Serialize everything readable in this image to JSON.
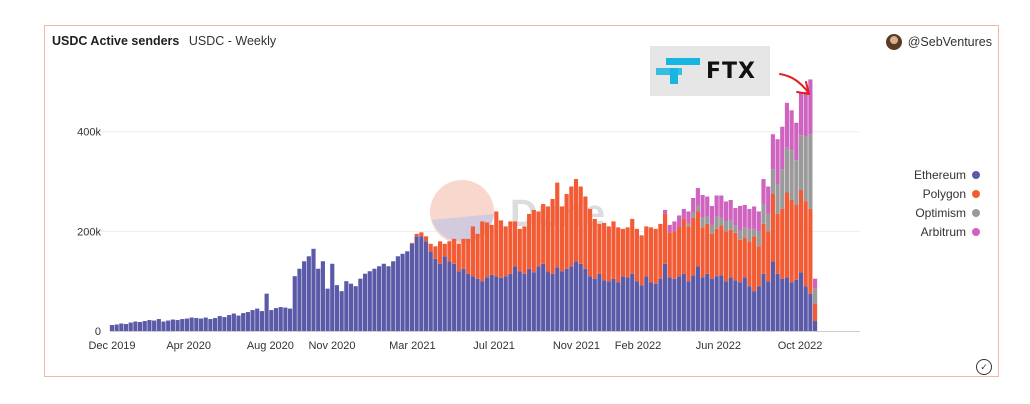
{
  "title": "USDC Active senders",
  "subtitle": "USDC - Weekly",
  "author": "@SebVentures",
  "annotation_logo_text": "FTX",
  "watermark": "Dune",
  "colors": {
    "ethereum": "#5a5aa8",
    "polygon": "#f25b34",
    "optimism": "#9a9a9a",
    "arbitrum": "#cf63c0",
    "annotation_arrow": "#e02020",
    "ftx_accent": "#17b5e1"
  },
  "icons": {
    "check": "check-circle-icon",
    "avatar": "avatar",
    "logo": "ftx-logo"
  },
  "chart_data": {
    "type": "bar",
    "stacked": true,
    "interval": "weekly",
    "start_week": "2019-12-09",
    "end_week": "2022-12-26",
    "ylim": [
      0,
      540000
    ],
    "yticks": [
      0,
      200000,
      400000
    ],
    "ytick_labels": [
      "0",
      "200k",
      "400k"
    ],
    "xtick_labels": [
      "Dec 2019",
      "Apr 2020",
      "Aug 2020",
      "Nov 2020",
      "Mar 2021",
      "Jul 2021",
      "Nov 2021",
      "Feb 2022",
      "Jun 2022",
      "Oct 2022"
    ],
    "xtick_dates": [
      "2019-12-01",
      "2020-04-01",
      "2020-08-01",
      "2020-11-01",
      "2021-03-01",
      "2021-07-01",
      "2021-11-01",
      "2022-02-01",
      "2022-06-01",
      "2022-10-01"
    ],
    "legend_position": "right",
    "grid": "horizontal",
    "series": [
      {
        "name": "Ethereum",
        "color": "#5a5aa8",
        "values": [
          12000,
          13000,
          15000,
          14000,
          17000,
          19000,
          18000,
          20000,
          22000,
          21000,
          24000,
          19000,
          21000,
          23000,
          22000,
          24000,
          25000,
          27000,
          26000,
          25000,
          27000,
          24000,
          26000,
          30000,
          28000,
          32000,
          35000,
          31000,
          36000,
          38000,
          42000,
          45000,
          40000,
          75000,
          42000,
          46000,
          48000,
          47000,
          45000,
          110000,
          125000,
          140000,
          150000,
          165000,
          125000,
          140000,
          85000,
          135000,
          92000,
          80000,
          100000,
          95000,
          90000,
          105000,
          115000,
          120000,
          125000,
          130000,
          135000,
          130000,
          140000,
          150000,
          155000,
          160000,
          175000,
          190000,
          190000,
          180000,
          160000,
          145000,
          135000,
          150000,
          140000,
          135000,
          120000,
          125000,
          115000,
          110000,
          105000,
          100000,
          108000,
          113000,
          110000,
          107000,
          110000,
          115000,
          130000,
          120000,
          115000,
          125000,
          118000,
          130000,
          135000,
          120000,
          115000,
          128000,
          120000,
          125000,
          130000,
          140000,
          135000,
          125000,
          110000,
          105000,
          115000,
          102000,
          100000,
          105000,
          98000,
          110000,
          108000,
          115000,
          100000,
          92000,
          110000,
          98000,
          95000,
          105000,
          135000,
          108000,
          105000,
          110000,
          115000,
          100000,
          112000,
          130000,
          108000,
          115000,
          105000,
          110000,
          112000,
          100000,
          108000,
          102000,
          98000,
          108000,
          90000,
          80000,
          90000,
          115000,
          100000,
          140000,
          115000,
          105000,
          108000,
          98000,
          103000,
          118000,
          90000,
          75000,
          20000
        ]
      },
      {
        "name": "Polygon",
        "color": "#f25b34",
        "values": [
          0,
          0,
          0,
          0,
          0,
          0,
          0,
          0,
          0,
          0,
          0,
          0,
          0,
          0,
          0,
          0,
          0,
          0,
          0,
          0,
          0,
          0,
          0,
          0,
          0,
          0,
          0,
          0,
          0,
          0,
          0,
          0,
          0,
          0,
          0,
          0,
          0,
          0,
          0,
          0,
          0,
          0,
          0,
          0,
          0,
          0,
          0,
          0,
          0,
          0,
          0,
          0,
          0,
          0,
          0,
          0,
          0,
          0,
          0,
          0,
          0,
          0,
          0,
          0,
          2000,
          5000,
          8000,
          10000,
          15000,
          25000,
          45000,
          25000,
          40000,
          50000,
          55000,
          60000,
          70000,
          100000,
          90000,
          120000,
          110000,
          100000,
          130000,
          115000,
          100000,
          105000,
          90000,
          85000,
          95000,
          110000,
          125000,
          110000,
          120000,
          130000,
          150000,
          170000,
          130000,
          150000,
          160000,
          165000,
          155000,
          145000,
          135000,
          120000,
          100000,
          115000,
          110000,
          115000,
          110000,
          95000,
          100000,
          110000,
          105000,
          100000,
          100000,
          110000,
          110000,
          110000,
          100000,
          90000,
          95000,
          100000,
          110000,
          110000,
          115000,
          110000,
          100000,
          100000,
          90000,
          95000,
          100000,
          100000,
          95000,
          95000,
          85000,
          80000,
          90000,
          110000,
          80000,
          100000,
          100000,
          135000,
          120000,
          140000,
          170000,
          165000,
          150000,
          165000,
          170000,
          170000,
          35000
        ]
      },
      {
        "name": "Optimism",
        "color": "#9a9a9a",
        "values": [
          0,
          0,
          0,
          0,
          0,
          0,
          0,
          0,
          0,
          0,
          0,
          0,
          0,
          0,
          0,
          0,
          0,
          0,
          0,
          0,
          0,
          0,
          0,
          0,
          0,
          0,
          0,
          0,
          0,
          0,
          0,
          0,
          0,
          0,
          0,
          0,
          0,
          0,
          0,
          0,
          0,
          0,
          0,
          0,
          0,
          0,
          0,
          0,
          0,
          0,
          0,
          0,
          0,
          0,
          0,
          0,
          0,
          0,
          0,
          0,
          0,
          0,
          0,
          0,
          0,
          0,
          0,
          0,
          0,
          0,
          0,
          0,
          0,
          0,
          0,
          0,
          0,
          0,
          0,
          0,
          0,
          0,
          0,
          0,
          0,
          0,
          0,
          0,
          0,
          0,
          0,
          0,
          0,
          0,
          0,
          0,
          0,
          0,
          0,
          0,
          0,
          0,
          0,
          0,
          0,
          0,
          0,
          0,
          0,
          0,
          0,
          0,
          0,
          0,
          0,
          0,
          0,
          0,
          0,
          0,
          0,
          0,
          0,
          5000,
          10000,
          12000,
          20000,
          15000,
          18000,
          25000,
          15000,
          20000,
          20000,
          15000,
          18000,
          20000,
          25000,
          15000,
          30000,
          40000,
          35000,
          50000,
          60000,
          80000,
          90000,
          100000,
          90000,
          110000,
          130000,
          150000,
          30000
        ]
      },
      {
        "name": "Arbitrum",
        "color": "#cf63c0",
        "values": [
          0,
          0,
          0,
          0,
          0,
          0,
          0,
          0,
          0,
          0,
          0,
          0,
          0,
          0,
          0,
          0,
          0,
          0,
          0,
          0,
          0,
          0,
          0,
          0,
          0,
          0,
          0,
          0,
          0,
          0,
          0,
          0,
          0,
          0,
          0,
          0,
          0,
          0,
          0,
          0,
          0,
          0,
          0,
          0,
          0,
          0,
          0,
          0,
          0,
          0,
          0,
          0,
          0,
          0,
          0,
          0,
          0,
          0,
          0,
          0,
          0,
          0,
          0,
          0,
          0,
          0,
          0,
          0,
          0,
          0,
          0,
          0,
          0,
          0,
          0,
          0,
          0,
          0,
          0,
          0,
          0,
          0,
          0,
          0,
          0,
          0,
          0,
          0,
          0,
          0,
          0,
          0,
          0,
          0,
          0,
          0,
          0,
          0,
          0,
          0,
          0,
          0,
          0,
          0,
          0,
          0,
          0,
          0,
          0,
          0,
          0,
          0,
          0,
          0,
          0,
          0,
          0,
          0,
          8000,
          15000,
          20000,
          22000,
          20000,
          25000,
          30000,
          35000,
          45000,
          40000,
          38000,
          42000,
          45000,
          40000,
          40000,
          35000,
          50000,
          45000,
          40000,
          45000,
          40000,
          50000,
          55000,
          70000,
          90000,
          85000,
          90000,
          80000,
          75000,
          85000,
          90000,
          110000,
          20000
        ]
      }
    ]
  }
}
